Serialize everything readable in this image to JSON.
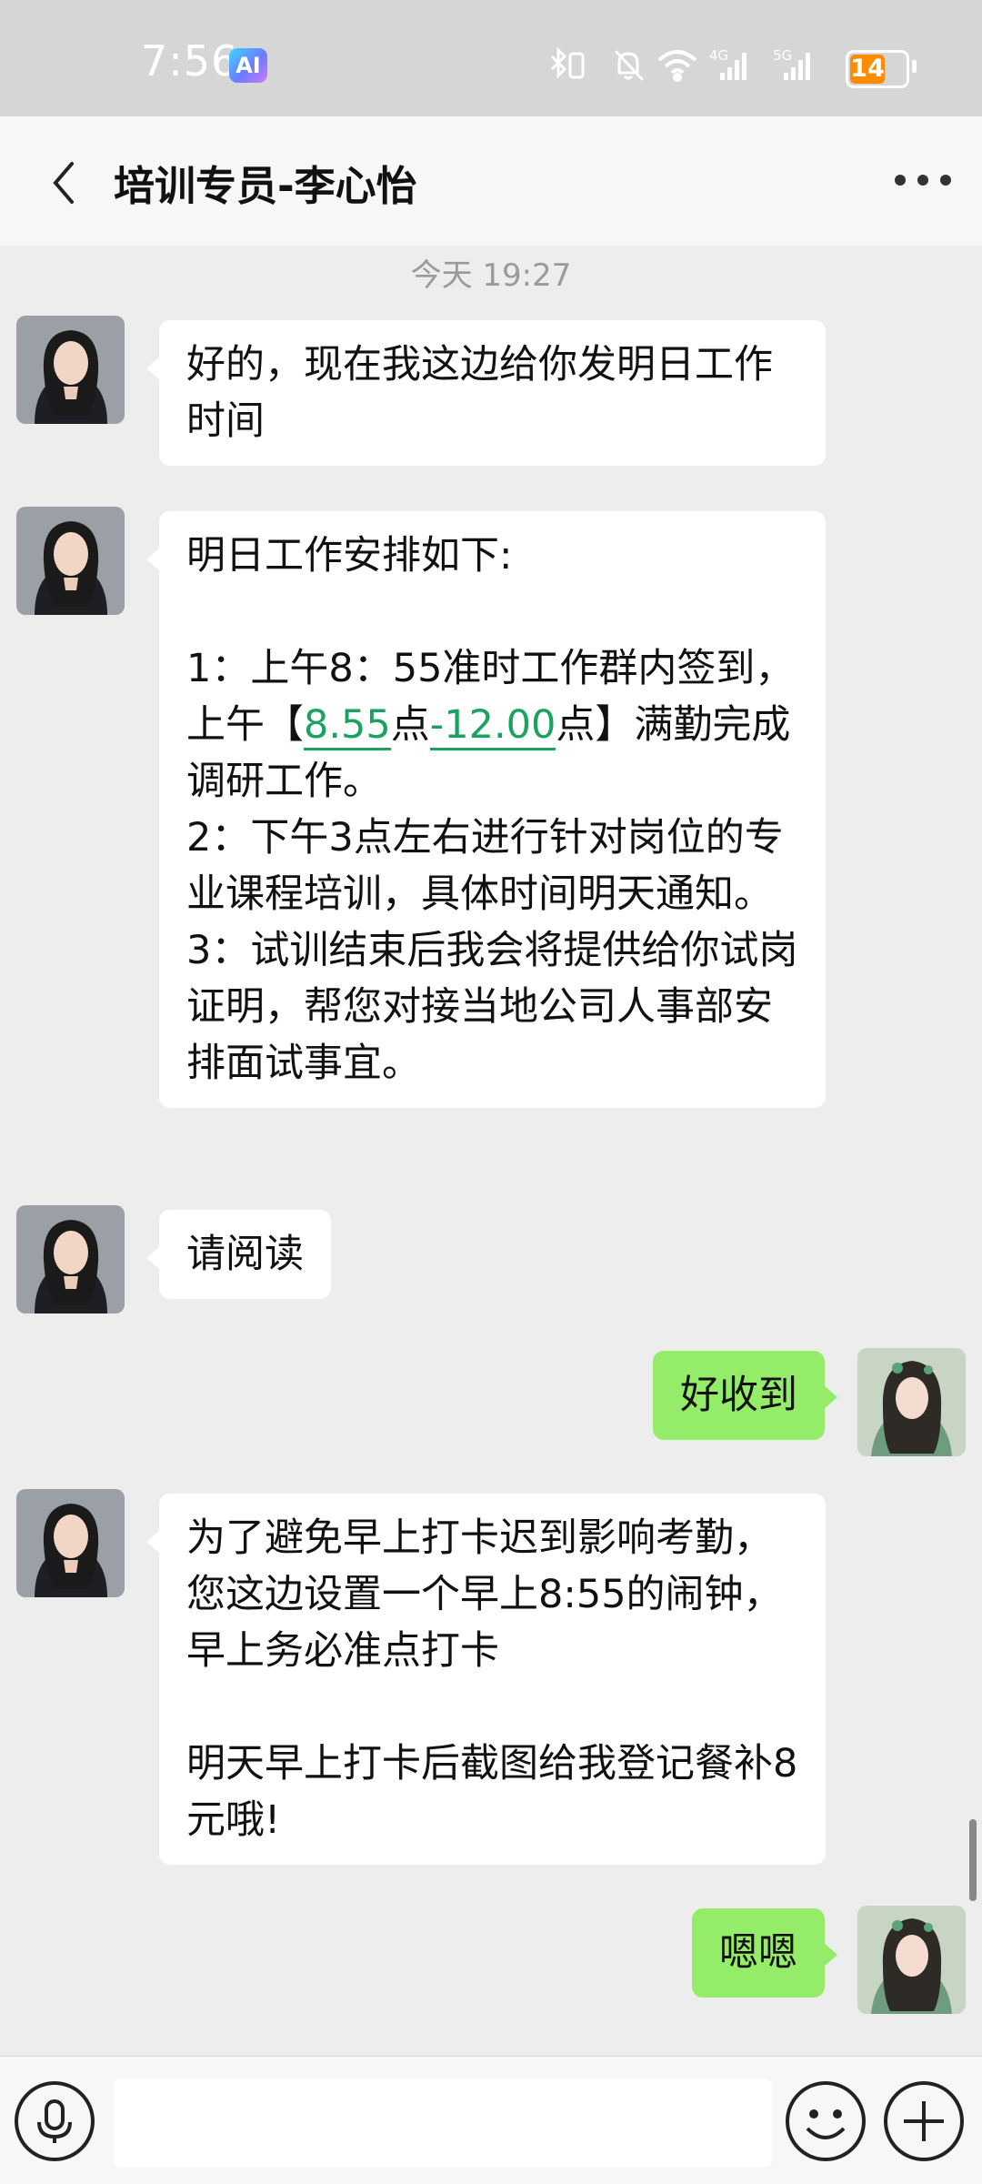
{
  "status": {
    "time": "7:56",
    "ai_badge": "AI",
    "battery": "14",
    "net1": "4G",
    "net2": "5G"
  },
  "header": {
    "title": "培训专员-李心怡"
  },
  "timestamp": "今天 19:27",
  "messages": {
    "m1": {
      "text": "好的，现在我这边给你发明日工作时间"
    },
    "m2": {
      "line1": "明日工作安排如下:",
      "p1_a": "1：上午8：55准时工作群内签到，上午【",
      "p1_link1": "8.55",
      "p1_b": "点",
      "p1_link2": "-12.00",
      "p1_c": "点】满勤完成调研工作。",
      "p2": "2：下午3点左右进行针对岗位的专业课程培训，具体时间明天通知。",
      "p3": "3：试训结束后我会将提供给你试岗证明，帮您对接当地公司人事部安排面试事宜。"
    },
    "m3": {
      "text": "请阅读"
    },
    "m4": {
      "text": "好收到"
    },
    "m5": {
      "part1": "为了避免早上打卡迟到影响考勤，您这边设置一个早上8:55的闹钟，早上务必准点打卡",
      "part2": "明天早上打卡后截图给我登记餐补8元哦!"
    },
    "m6": {
      "text": "嗯嗯"
    }
  },
  "colors": {
    "bubble_out": "#95ec69",
    "link": "#1aa261",
    "battery": "#ff8c00"
  }
}
